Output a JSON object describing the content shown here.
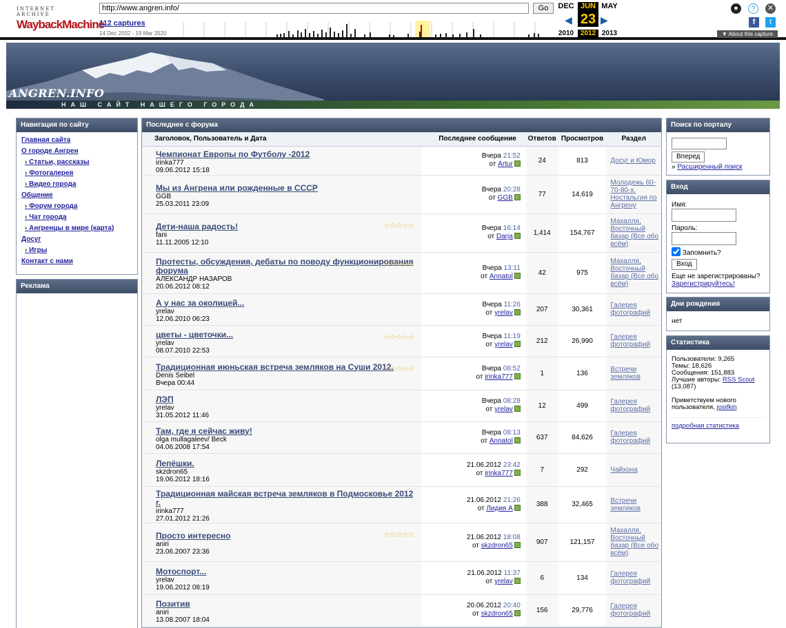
{
  "wayback": {
    "brand_top": "INTERNET ARCHIVE",
    "brand_main": "WaybackMachine",
    "url": "http://www.angren.info/",
    "go": "Go",
    "captures": "112 captures",
    "range": "14 Dec 2002 - 19 Mar 2020",
    "months": [
      "DEC",
      "JUN",
      "MAY"
    ],
    "day": "23",
    "years": [
      "2010",
      "2012",
      "2013"
    ],
    "about": "▼ About this capture"
  },
  "header": {
    "brand": "ANGREN.INFO",
    "tagline": "НАШ САЙТ НАШЕГО ГОРОДА"
  },
  "nav": {
    "title": "Навигация по сайту",
    "items": [
      {
        "label": "Главная сайта"
      },
      {
        "label": "О городе Ангрен"
      },
      {
        "label": "Статьи, рассказы"
      },
      {
        "label": "Фотогалерея"
      },
      {
        "label": "Видео города"
      },
      {
        "label": "Общение"
      },
      {
        "label": "Форум города"
      },
      {
        "label": "Чат города"
      },
      {
        "label": "Ангренцы в мире (карта)"
      },
      {
        "label": "Досуг"
      },
      {
        "label": "Игры"
      },
      {
        "label": "Контакт с нами"
      }
    ]
  },
  "ads": {
    "title": "Реклама"
  },
  "forum": {
    "title": "Последнее с форума",
    "cols": [
      "Заголовок, Пользователь и Дата",
      "Последнее сообщение",
      "Ответов",
      "Просмотров",
      "Раздел"
    ],
    "rows": [
      {
        "title": "Чемпионат Европы по Футболу -2012",
        "user": "irinka777",
        "date": "09.06.2012 15:18",
        "stars": false,
        "last_day": "Вчера",
        "last_time": "21:52",
        "from": "от",
        "last_user": "Artur",
        "replies": "24",
        "views": "813",
        "section": "Досуг и Юмор"
      },
      {
        "title": "Мы из Ангрена или рожденные в СССР",
        "user": "GGB",
        "date": "25.03.2011 23:09",
        "stars": false,
        "last_day": "Вчера",
        "last_time": "20:28",
        "from": "от",
        "last_user": "GGB",
        "replies": "77",
        "views": "14,619",
        "section": "Молодежь 60-70-80-х. Ностальгия по Ангрену"
      },
      {
        "title": "Дети-наша радость!",
        "user": "fani",
        "date": "11.11.2005 12:10",
        "stars": true,
        "last_day": "Вчера",
        "last_time": "16:14",
        "from": "от",
        "last_user": "Darja",
        "replies": "1,414",
        "views": "154,767",
        "section": "Махалля, Восточный базар (Все обо всём)"
      },
      {
        "title": "Протесты, обсуждения, дебаты по поводу функционирования форума",
        "user": "АЛЕКСАНДР НАЗАРОВ",
        "date": "20.06.2012 08:12",
        "stars": true,
        "last_day": "Вчера",
        "last_time": "13:11",
        "from": "от",
        "last_user": "Annatol",
        "replies": "42",
        "views": "975",
        "section": "Махалля, Восточный базар (Все обо всём)"
      },
      {
        "title": "А у нас за околицей...",
        "user": "yrelav",
        "date": "12.06.2010 06:23",
        "stars": false,
        "last_day": "Вчера",
        "last_time": "11:26",
        "from": "от",
        "last_user": "yrelav",
        "replies": "207",
        "views": "30,361",
        "section": "Галерея фотографий"
      },
      {
        "title": "цветы - цветочки...",
        "user": "yrelav",
        "date": "08.07.2010 22:53",
        "stars": true,
        "last_day": "Вчера",
        "last_time": "11:19",
        "from": "от",
        "last_user": "yrelav",
        "replies": "212",
        "views": "26,990",
        "section": "Галерея фотографий"
      },
      {
        "title": "Традиционная июньская встреча земляков на Суши 2012.",
        "user": "Denis Seibel",
        "date": "Вчера 00:44",
        "stars": true,
        "last_day": "Вчера",
        "last_time": "08:52",
        "from": "от",
        "last_user": "irinka777",
        "replies": "1",
        "views": "136",
        "section": "Встречи земляков"
      },
      {
        "title": "ЛЭП",
        "user": "yrelav",
        "date": "31.05.2012 11:46",
        "stars": false,
        "last_day": "Вчера",
        "last_time": "08:28",
        "from": "от",
        "last_user": "yrelav",
        "replies": "12",
        "views": "499",
        "section": "Галерея фотографий"
      },
      {
        "title": "Там, где я сейчас живу!",
        "user": "olga mullagaleev/ Beck",
        "date": "04.06.2008 17:54",
        "stars": false,
        "last_day": "Вчера",
        "last_time": "08:13",
        "from": "от",
        "last_user": "Annatol",
        "replies": "637",
        "views": "84,626",
        "section": "Галерея фотографий"
      },
      {
        "title": "Лепёшки.",
        "user": "skzdron65",
        "date": "19.06.2012 18:16",
        "stars": false,
        "last_day": "21.06.2012",
        "last_time": "23:42",
        "from": "от",
        "last_user": "irinka777",
        "replies": "7",
        "views": "292",
        "section": "Чайхона"
      },
      {
        "title": "Традиционная майская встреча земляков в Подмосковье 2012 г.",
        "user": "irinka777",
        "date": "27.01.2012 21:26",
        "stars": false,
        "last_day": "21.06.2012",
        "last_time": "21:26",
        "from": "от",
        "last_user": "Лидия А",
        "replies": "388",
        "views": "32,465",
        "section": "Встречи земляков"
      },
      {
        "title": "Просто интересно",
        "user": "aniri",
        "date": "23.06.2007 23:36",
        "stars": true,
        "last_day": "21.06.2012",
        "last_time": "18:08",
        "from": "от",
        "last_user": "skzdron65",
        "replies": "907",
        "views": "121,157",
        "section": "Махалля, Восточный базар (Все обо всём)"
      },
      {
        "title": "Мотоспорт...",
        "user": "yrelav",
        "date": "19.06.2012 08:19",
        "stars": false,
        "last_day": "21.06.2012",
        "last_time": "11:37",
        "from": "от",
        "last_user": "yrelav",
        "replies": "6",
        "views": "134",
        "section": "Галерея фотографий"
      },
      {
        "title": "Позитив",
        "user": "aniri",
        "date": "13.08.2007 18:04",
        "stars": false,
        "last_day": "20.06.2012",
        "last_time": "20:40",
        "from": "от",
        "last_user": "skzdron65",
        "replies": "156",
        "views": "29,776",
        "section": "Галерея фотографий"
      }
    ]
  },
  "search": {
    "title": "Поиск по порталу",
    "button": "Вперед",
    "advanced_prefix": "»",
    "advanced": "Расширенный поиск"
  },
  "login": {
    "title": "Вход",
    "name_label": "Имя:",
    "pass_label": "Пароль:",
    "remember": "Запомнить?",
    "button": "Вход",
    "not_registered": "Еще не зарегистрированы?",
    "register": "Зарегистрируйтесь!"
  },
  "birthdays": {
    "title": "Дни рождения",
    "text": "нет"
  },
  "stats": {
    "title": "Статистика",
    "users": "Пользователи: 9,265",
    "topics": "Темы: 18,626",
    "posts": "Сообщения: 151,883",
    "best_prefix": "Лучшие авторы:",
    "best_user": "RSS Scout",
    "best_count": "(13,087)",
    "welcome": "Приветствуем нового пользователя,",
    "welcome_user": "josifkin",
    "more": "подробная статистика"
  },
  "colors": {
    "box_header": "#4a5a74",
    "link": "#22229c",
    "accent_yellow": "#ffcc00"
  }
}
